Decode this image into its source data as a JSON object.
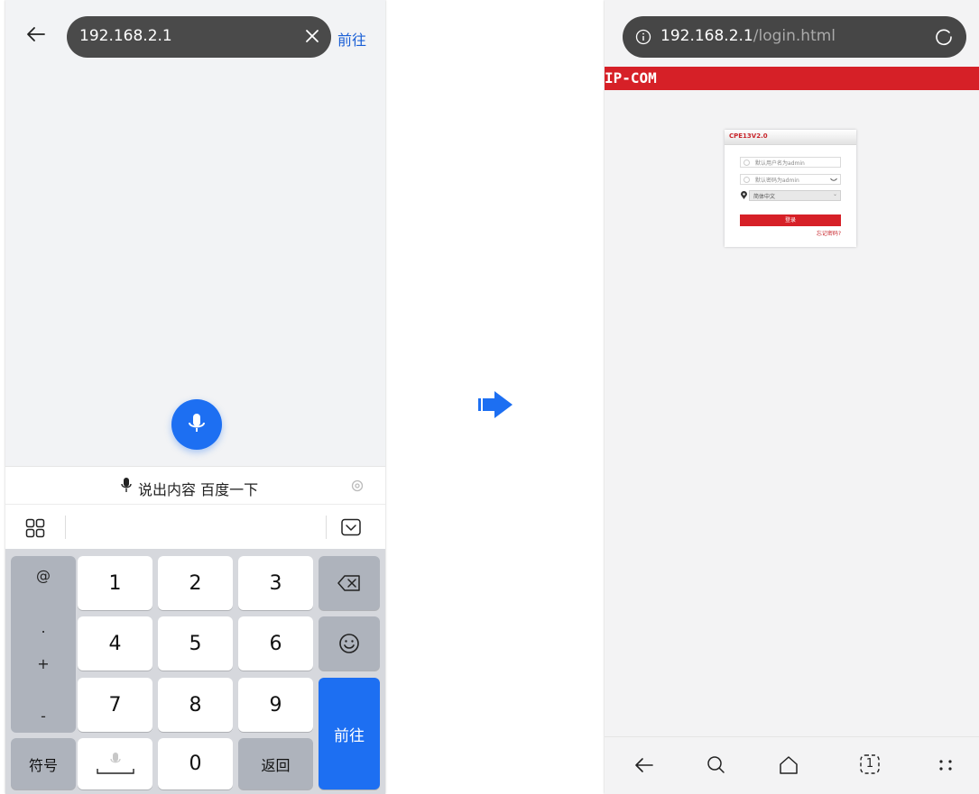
{
  "left": {
    "address_input": "192.168.2.1",
    "go_link": "前往",
    "voice_prompt": "说出内容 百度一下",
    "keys": {
      "symbols": [
        "@",
        ".",
        "+",
        "-"
      ],
      "row1": [
        "1",
        "2",
        "3"
      ],
      "row2": [
        "4",
        "5",
        "6"
      ],
      "row3": [
        "7",
        "8",
        "9"
      ],
      "symbol_key": "符号",
      "zero": "0",
      "return_key": "返回",
      "go_key": "前往"
    }
  },
  "right": {
    "url_host": "192.168.2.1",
    "url_path": "/login.html",
    "brand": "IP-COM",
    "card_title": "CPE13V2.0",
    "username_placeholder": "默认用户名为admin",
    "password_placeholder": "默认密码为admin",
    "language": "简体中文",
    "login_button": "登录",
    "forgot_link": "忘记密码?",
    "tab_count": "1"
  },
  "colors": {
    "accent_blue": "#1d6ff2",
    "brand_red": "#d62027",
    "url_pill": "#4a4a4a"
  }
}
